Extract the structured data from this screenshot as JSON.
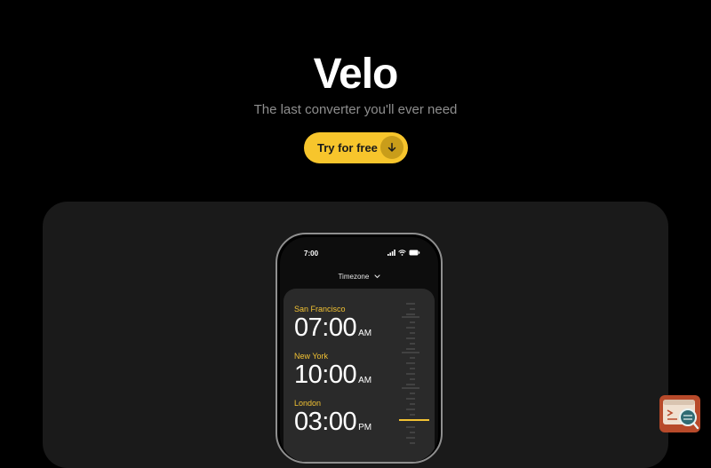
{
  "hero": {
    "title": "Velo",
    "subtitle": "The last converter you'll ever need",
    "cta_label": "Try for free"
  },
  "phone": {
    "status_time": "7:00",
    "mode_label": "Timezone",
    "zones": [
      {
        "name": "San Francisco",
        "time": "07:00",
        "ampm": "AM"
      },
      {
        "name": "New York",
        "time": "10:00",
        "ampm": "AM"
      },
      {
        "name": "London",
        "time": "03:00",
        "ampm": "PM"
      }
    ]
  },
  "colors": {
    "accent": "#f7c52c",
    "background": "#000000",
    "card": "#1a1a1a",
    "panel": "#2a2a2a"
  },
  "icons": {
    "cta": "arrow-down-icon",
    "signal": "signal-icon",
    "wifi": "wifi-icon",
    "battery": "battery-icon",
    "mode": "chevron-down-icon",
    "fab": "terminal-search-icon"
  }
}
